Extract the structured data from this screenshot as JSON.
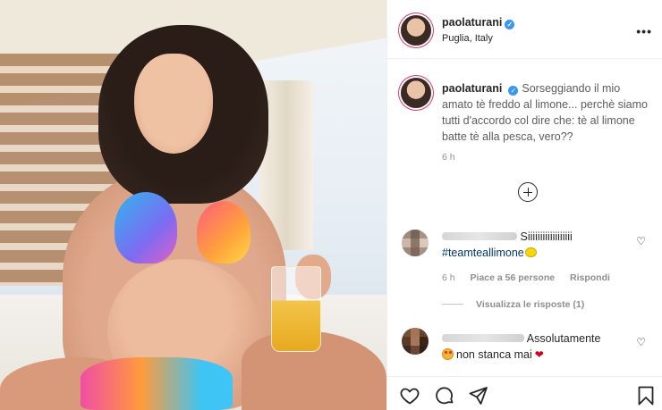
{
  "post": {
    "username": "paolaturani",
    "location": "Puglia, Italy",
    "more_icon": "more-horizontal-icon",
    "caption": {
      "username": "paolaturani",
      "text": "Sorseggiando il mio amato tè freddo al limone... perchè siamo tutti d'accordo col dire che: tè al limone batte tè alla pesca, vero??",
      "time": "6 h"
    },
    "load_more_icon": "plus-circle-icon",
    "comments": [
      {
        "text": "Siiiiiiiiiiiiiiiiii",
        "hashtag": "#teamteallimone",
        "emoji": "lemon",
        "time": "6 h",
        "likes": "Piace a 56 persone",
        "reply": "Rispondi",
        "view_replies": "Visualizza le risposte (1)"
      },
      {
        "text": "Assolutamente",
        "text2": "non stanca mai",
        "emoji_start": "smiling-face-with-hearts",
        "emoji_end": "mending-heart"
      }
    ],
    "actions": {
      "like": "heart-icon",
      "comment": "comment-icon",
      "share": "send-icon",
      "save": "bookmark-icon"
    }
  }
}
